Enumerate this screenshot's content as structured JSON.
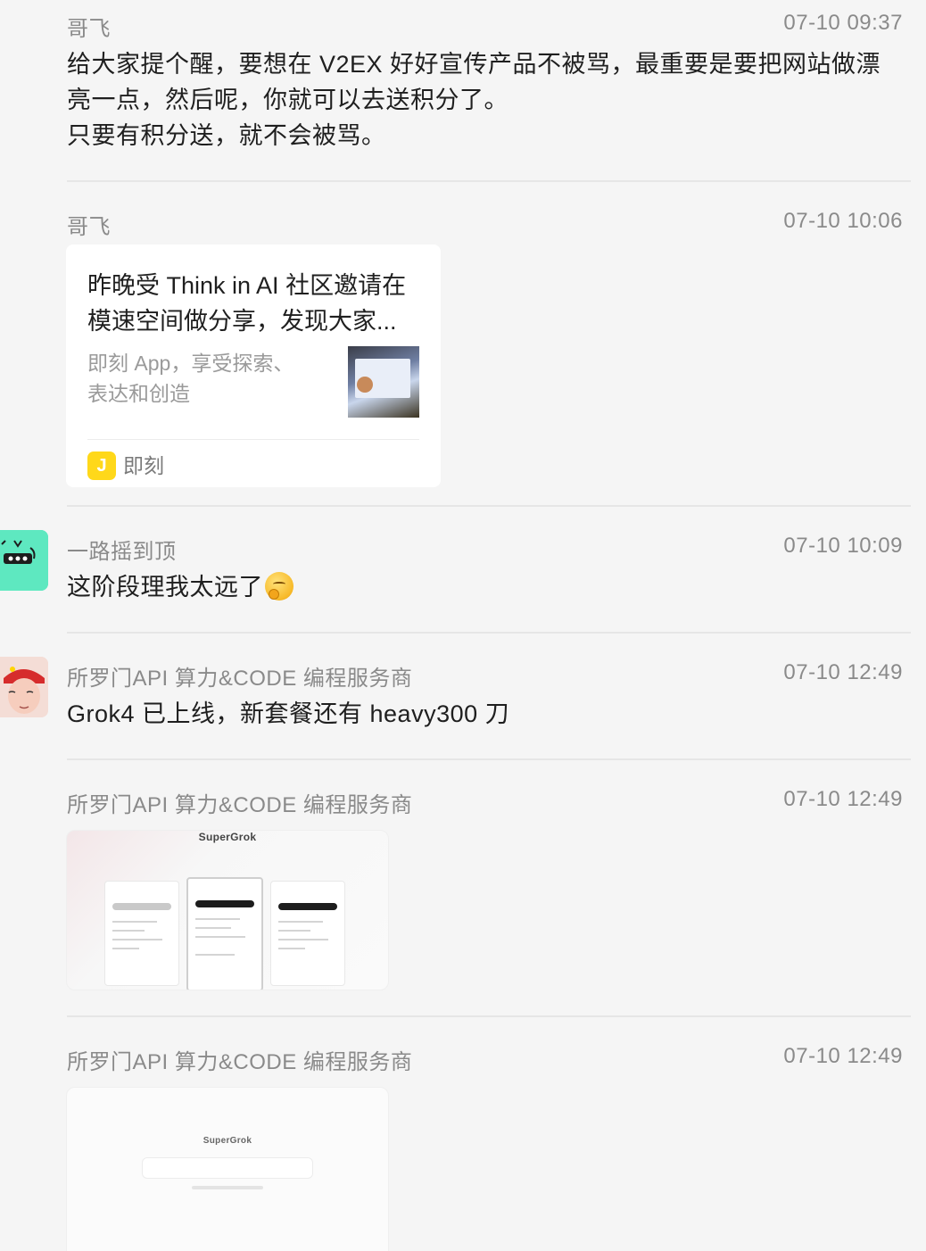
{
  "messages": [
    {
      "sender": "哥飞",
      "time": "07-10 09:37",
      "lines": [
        "给大家提个醒，要想在 V2EX 好好宣传产品不被骂，最重要是要把网站做漂",
        "亮一点，然后呢，你就可以去送积分了。",
        "只要有积分送，就不会被骂。"
      ]
    },
    {
      "sender": "哥飞",
      "time": "07-10 10:06",
      "card": {
        "title_lines": [
          "昨晚受 Think in AI 社区邀请在",
          "模速空间做分享，发现大家..."
        ],
        "desc_lines": [
          "即刻 App，享受探索、",
          "表达和创造"
        ],
        "source_icon": "J",
        "source": "即刻"
      }
    },
    {
      "sender": "一路摇到顶",
      "time": "07-10 10:09",
      "text": "这阶段理我太远了",
      "emoji": "thinking-face",
      "avatar_color": "#5ee8c0"
    },
    {
      "sender": "所罗门API 算力&CODE 编程服务商",
      "time": "07-10 12:49",
      "text": "Grok4 已上线，新套餐还有 heavy300 刀"
    },
    {
      "sender": "所罗门API 算力&CODE 编程服务商",
      "time": "07-10 12:49",
      "image_brand": "SuperGrok"
    },
    {
      "sender": "所罗门API 算力&CODE 编程服务商",
      "time": "07-10 12:49",
      "image_brand": "SuperGrok"
    }
  ]
}
